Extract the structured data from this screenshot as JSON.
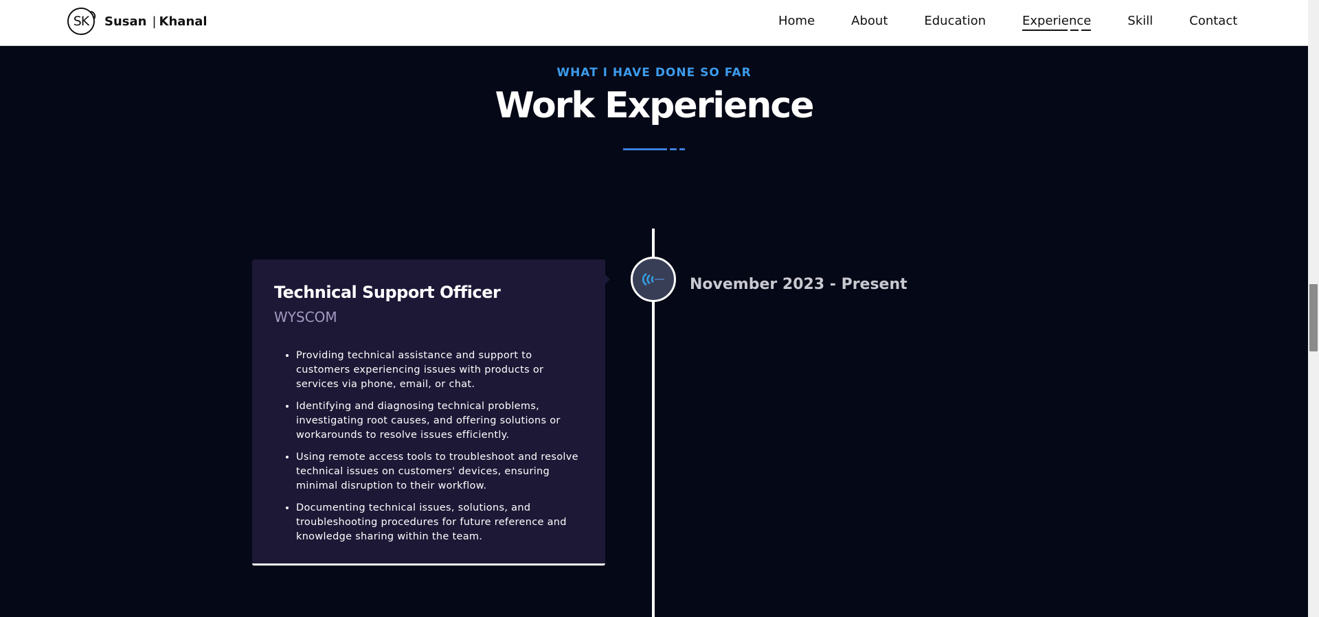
{
  "nav": {
    "logo_initials": "SK",
    "brand_first": "Susan",
    "brand_sep": "|",
    "brand_last": "Khanal",
    "links": [
      "Home",
      "About",
      "Education",
      "Experience",
      "Skill",
      "Contact"
    ],
    "active": "Experience"
  },
  "section": {
    "eyebrow": "WHAT I HAVE DONE SO FAR",
    "title": "Work Experience"
  },
  "experience": {
    "date": "November 2023 - Present",
    "icon": "company-logo-icon",
    "title": "Technical Support Officer",
    "company": "WYSCOM",
    "points": [
      "Providing technical assistance and support to customers experiencing issues with products or services via phone, email, or chat.",
      "Identifying and diagnosing technical problems, investigating root causes, and offering solutions or workarounds to resolve issues efficiently.",
      "Using remote access tools to troubleshoot and resolve technical issues on customers' devices, ensuring minimal disruption to their workflow.",
      "Documenting technical issues, solutions, and troubleshooting procedures for future reference and knowledge sharing within the team."
    ]
  },
  "colors": {
    "background": "#050816",
    "accent": "#3d9bec",
    "card": "#1d1836",
    "company_text": "#a59bc2"
  }
}
